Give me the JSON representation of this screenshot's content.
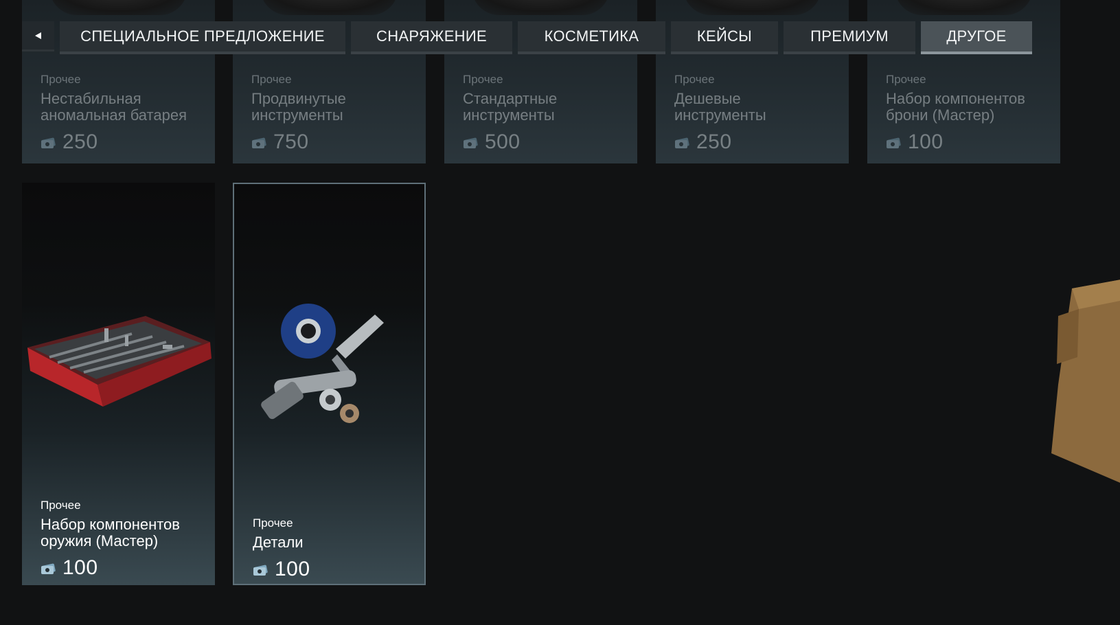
{
  "tabs": {
    "back_icon": "triangle-left-icon",
    "items": [
      {
        "label": "СПЕЦИАЛЬНОЕ ПРЕДЛОЖЕНИЕ",
        "active": false
      },
      {
        "label": "СНАРЯЖЕНИЕ",
        "active": false
      },
      {
        "label": "КОСМЕТИКА",
        "active": false
      },
      {
        "label": "КЕЙСЫ",
        "active": false
      },
      {
        "label": "ПРЕМИУМ",
        "active": false
      },
      {
        "label": "ДРУГОЕ",
        "active": true
      }
    ]
  },
  "currency_icon": "coupons-icon",
  "items_top": [
    {
      "category": "Прочее",
      "name_line1": "Нестабильная",
      "name_line2": "аномальная батарея",
      "price": "250"
    },
    {
      "category": "Прочее",
      "name_line1": "Продвинутые",
      "name_line2": "инструменты",
      "price": "750"
    },
    {
      "category": "Прочее",
      "name_line1": "Стандартные",
      "name_line2": "инструменты",
      "price": "500"
    },
    {
      "category": "Прочее",
      "name_line1": "Дешевые",
      "name_line2": "инструменты",
      "price": "250"
    },
    {
      "category": "Прочее",
      "name_line1": "Набор компонентов",
      "name_line2": "брони (Мастер)",
      "price": "100"
    }
  ],
  "items_bottom": [
    {
      "category": "Прочее",
      "name_line1": "Набор компонентов",
      "name_line2": "оружия (Мастер)",
      "price": "100",
      "icon": "red-toolbox-icon"
    },
    {
      "category": "Прочее",
      "name_line1": "Детали",
      "name_line2": "",
      "price": "100",
      "icon": "parts-and-tape-icon",
      "selected": true
    }
  ],
  "colors": {
    "background": "#111213",
    "tab": "#2a3034",
    "tab_active": "#4b5358",
    "selected_border": "#5f7079",
    "coin": "#7fa8bf"
  }
}
